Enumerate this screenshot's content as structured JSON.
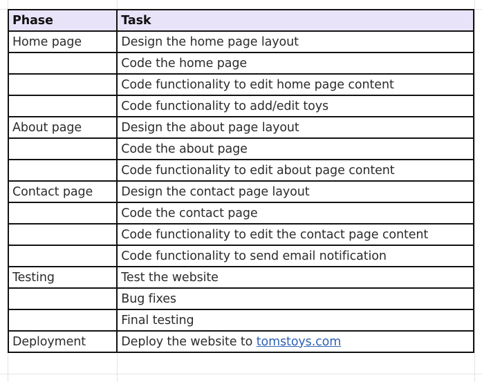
{
  "table": {
    "headers": [
      "Phase",
      "Task"
    ],
    "header_bg": "#e9e3f9",
    "link_color": "#2f62b5",
    "rows": [
      {
        "phase": "Home page",
        "task": "Design the home page layout"
      },
      {
        "phase": "",
        "task": "Code the home page"
      },
      {
        "phase": "",
        "task": "Code functionality to edit home page content"
      },
      {
        "phase": "",
        "task": "Code functionality to add/edit toys"
      },
      {
        "phase": "About page",
        "task": "Design the about page layout"
      },
      {
        "phase": "",
        "task": "Code the about page"
      },
      {
        "phase": "",
        "task": "Code functionality to edit about page content"
      },
      {
        "phase": "Contact page",
        "task": "Design the contact page layout"
      },
      {
        "phase": "",
        "task": "Code the contact page"
      },
      {
        "phase": "",
        "task": "Code functionality to edit the contact page content"
      },
      {
        "phase": "",
        "task": "Code functionality to send email notification"
      },
      {
        "phase": "Testing",
        "task": "Test the website"
      },
      {
        "phase": "",
        "task": "Bug fixes"
      },
      {
        "phase": "",
        "task": "Final testing"
      },
      {
        "phase": "Deployment",
        "task": "Deploy the website to ",
        "link": "tomstoys.com"
      }
    ]
  }
}
